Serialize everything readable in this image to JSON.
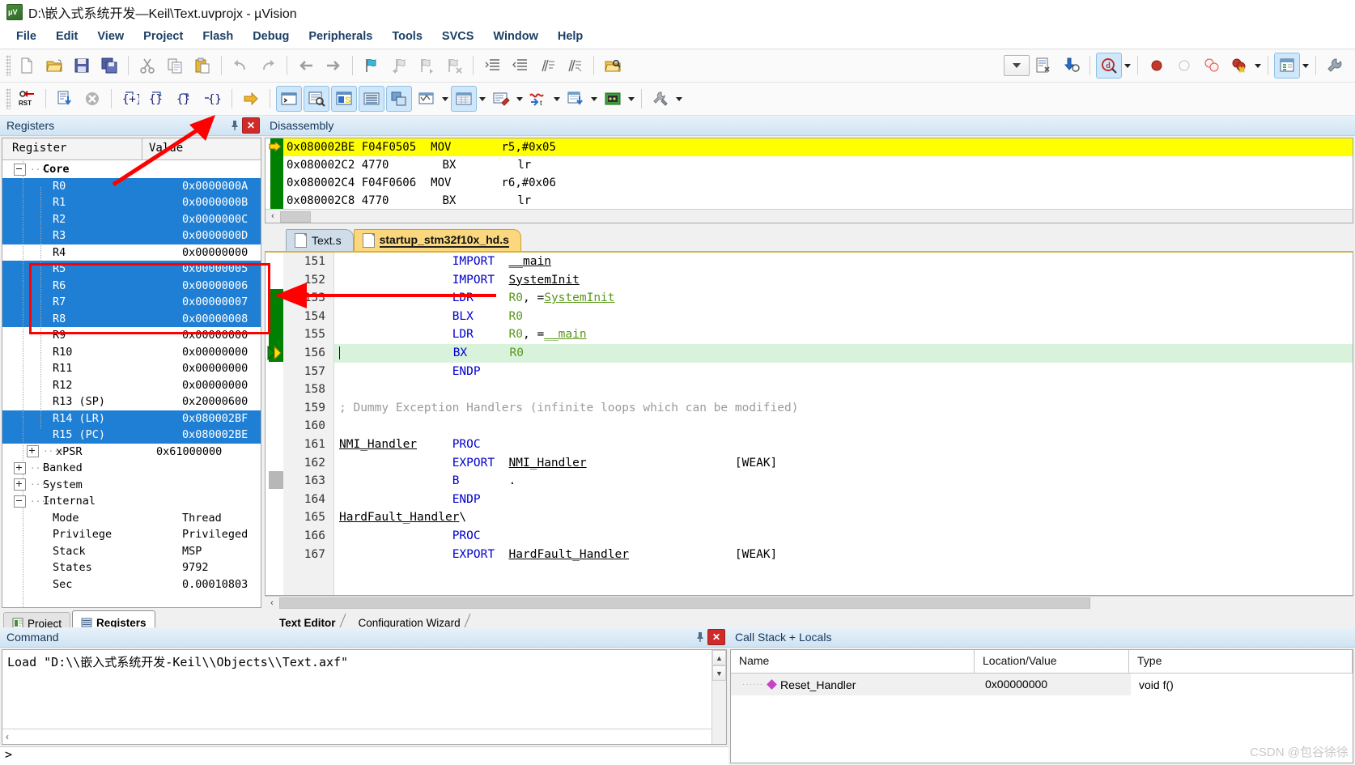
{
  "window": {
    "title": "D:\\嵌入式系统开发—Keil\\Text.uvprojx - µVision",
    "icon": "uvision-logo-icon"
  },
  "menubar": {
    "items": [
      "File",
      "Edit",
      "View",
      "Project",
      "Flash",
      "Debug",
      "Peripherals",
      "Tools",
      "SVCS",
      "Window",
      "Help"
    ]
  },
  "toolbar_main": {
    "icons": [
      "new-file-icon",
      "open-file-icon",
      "save-icon",
      "save-all-icon",
      "cut-icon",
      "copy-icon",
      "paste-icon",
      "undo-icon",
      "redo-icon",
      "navigate-back-icon",
      "navigate-forward-icon",
      "bookmark-toggle-icon",
      "bookmark-prev-icon",
      "bookmark-next-icon",
      "bookmark-clear-icon",
      "indent-icon",
      "outdent-icon",
      "comment-icon",
      "uncomment-icon",
      "find-in-files-icon"
    ],
    "right_icons": [
      "combo-empty",
      "build-target-icon",
      "download-icon",
      "start-debug-icon",
      "insert-breakpoint-icon",
      "disable-breakpoint-icon",
      "disable-all-breakpoints-icon",
      "kill-all-breakpoints-icon",
      "manage-windows-icon",
      "configure-icon"
    ]
  },
  "toolbar_debug": {
    "icons": [
      "reset-cpu-icon",
      "run-icon",
      "stop-icon",
      "step-into-icon",
      "step-over-icon",
      "step-out-icon",
      "run-to-cursor-icon",
      "show-next-statement-icon",
      "command-window-icon",
      "disassembly-window-icon",
      "symbols-window-icon",
      "registers-window-icon",
      "call-stack-window-icon",
      "watch-window-icon",
      "memory-window-icon",
      "serial-window-icon",
      "analysis-window-icon",
      "trace-window-icon",
      "system-viewer-icon",
      "toolbox-icon"
    ]
  },
  "registers_panel": {
    "title": "Registers",
    "pin_icon": "pin-icon",
    "close_icon": "close-icon",
    "columns": [
      "Register",
      "Value"
    ],
    "groups": [
      {
        "name": "Core",
        "expanded": true
      }
    ],
    "rows": [
      {
        "name": "R0",
        "value": "0x0000000A",
        "selected": true,
        "indent": 2
      },
      {
        "name": "R1",
        "value": "0x0000000B",
        "selected": true,
        "indent": 2
      },
      {
        "name": "R2",
        "value": "0x0000000C",
        "selected": true,
        "indent": 2
      },
      {
        "name": "R3",
        "value": "0x0000000D",
        "selected": true,
        "indent": 2
      },
      {
        "name": "R4",
        "value": "0x00000000",
        "selected": false,
        "indent": 2
      },
      {
        "name": "R5",
        "value": "0x00000005",
        "selected": true,
        "indent": 2
      },
      {
        "name": "R6",
        "value": "0x00000006",
        "selected": true,
        "indent": 2
      },
      {
        "name": "R7",
        "value": "0x00000007",
        "selected": true,
        "indent": 2
      },
      {
        "name": "R8",
        "value": "0x00000008",
        "selected": true,
        "indent": 2
      },
      {
        "name": "R9",
        "value": "0x00000000",
        "selected": false,
        "indent": 2
      },
      {
        "name": "R10",
        "value": "0x00000000",
        "selected": false,
        "indent": 2
      },
      {
        "name": "R11",
        "value": "0x00000000",
        "selected": false,
        "indent": 2
      },
      {
        "name": "R12",
        "value": "0x00000000",
        "selected": false,
        "indent": 2
      },
      {
        "name": "R13 (SP)",
        "value": "0x20000600",
        "selected": false,
        "indent": 2
      },
      {
        "name": "R14 (LR)",
        "value": "0x080002BF",
        "selected": true,
        "indent": 2
      },
      {
        "name": "R15 (PC)",
        "value": "0x080002BE",
        "selected": true,
        "indent": 2
      }
    ],
    "xpsr": {
      "name": "xPSR",
      "value": "0x61000000",
      "expandable": true
    },
    "collapsed_groups": [
      "Banked",
      "System"
    ],
    "internal": {
      "name": "Internal",
      "items": [
        {
          "name": "Mode",
          "value": "Thread"
        },
        {
          "name": "Privilege",
          "value": "Privileged"
        },
        {
          "name": "Stack",
          "value": "MSP"
        },
        {
          "name": "States",
          "value": "9792"
        },
        {
          "name": "Sec",
          "value": "0.00010803"
        }
      ]
    },
    "bottom_tabs": [
      {
        "label": "Project",
        "icon": "project-icon",
        "selected": false
      },
      {
        "label": "Registers",
        "icon": "registers-icon",
        "selected": true
      }
    ]
  },
  "disassembly_panel": {
    "title": "Disassembly",
    "current_marker": "yellow-arrow-icon",
    "lines": [
      {
        "addr": "0x080002BE",
        "opcode": "F04F0505",
        "mnemonic": "MOV",
        "operands": "r5,#0x05",
        "current": true
      },
      {
        "addr": "0x080002C2",
        "opcode": "4770",
        "mnemonic": "BX",
        "operands": "lr",
        "current": false
      },
      {
        "addr": "0x080002C4",
        "opcode": "F04F0606",
        "mnemonic": "MOV",
        "operands": "r6,#0x06",
        "current": false
      },
      {
        "addr": "0x080002C8",
        "opcode": "4770",
        "mnemonic": "BX",
        "operands": "lr",
        "current": false
      }
    ]
  },
  "editor": {
    "tabs": [
      {
        "label": "Text.s",
        "active": false
      },
      {
        "label": "startup_stm32f10x_hd.s",
        "active": true
      }
    ],
    "lines": [
      {
        "num": "151",
        "text": "                IMPORT  __main",
        "hl": false
      },
      {
        "num": "152",
        "text": "                IMPORT  SystemInit",
        "hl": false
      },
      {
        "num": "153",
        "text": "                LDR     R0, =SystemInit",
        "hl": false
      },
      {
        "num": "154",
        "text": "                BLX     R0",
        "hl": false
      },
      {
        "num": "155",
        "text": "                LDR     R0, =__main",
        "hl": false
      },
      {
        "num": "156",
        "text": "                BX      R0",
        "hl": true
      },
      {
        "num": "157",
        "text": "                ENDP",
        "hl": false
      },
      {
        "num": "158",
        "text": "",
        "hl": false
      },
      {
        "num": "159",
        "text": "; Dummy Exception Handlers (infinite loops which can be modified)",
        "hl": false
      },
      {
        "num": "160",
        "text": "",
        "hl": false
      },
      {
        "num": "161",
        "text": "NMI_Handler     PROC",
        "hl": false
      },
      {
        "num": "162",
        "text": "                EXPORT  NMI_Handler                     [WEAK]",
        "hl": false
      },
      {
        "num": "163",
        "text": "                B       .",
        "hl": false
      },
      {
        "num": "164",
        "text": "                ENDP",
        "hl": false
      },
      {
        "num": "165",
        "text": "HardFault_Handler\\",
        "hl": false
      },
      {
        "num": "166",
        "text": "                PROC",
        "hl": false
      },
      {
        "num": "167",
        "text": "                EXPORT  HardFault_Handler               [WEAK]",
        "hl": false
      }
    ],
    "bottom_tabs": [
      {
        "label": "Text Editor",
        "selected": true
      },
      {
        "label": "Configuration Wizard",
        "selected": false
      }
    ]
  },
  "command_panel": {
    "title": "Command",
    "pin_icon": "pin-icon",
    "close_icon": "close-icon",
    "output": "Load \"D:\\\\嵌入式系统开发-Keil\\\\Objects\\\\Text.axf\"",
    "prompt": ">"
  },
  "callstack_panel": {
    "title": "Call Stack + Locals",
    "columns": [
      "Name",
      "Location/Value",
      "Type"
    ],
    "rows": [
      {
        "name": "Reset_Handler",
        "location": "0x00000000",
        "type": "void f()",
        "icon": "function-diamond-icon"
      }
    ]
  },
  "watermark": "CSDN @包谷徐徐",
  "colors": {
    "selection_blue": "#1f7fd4",
    "current_line_yellow": "#ffff00",
    "exec_line_green": "#d9f2dc",
    "marker_green": "#008000",
    "annotation_red": "#ff0000",
    "keyword_blue": "#0000cd",
    "register_green": "#59981a",
    "comment_gray": "#9b9b9b"
  }
}
